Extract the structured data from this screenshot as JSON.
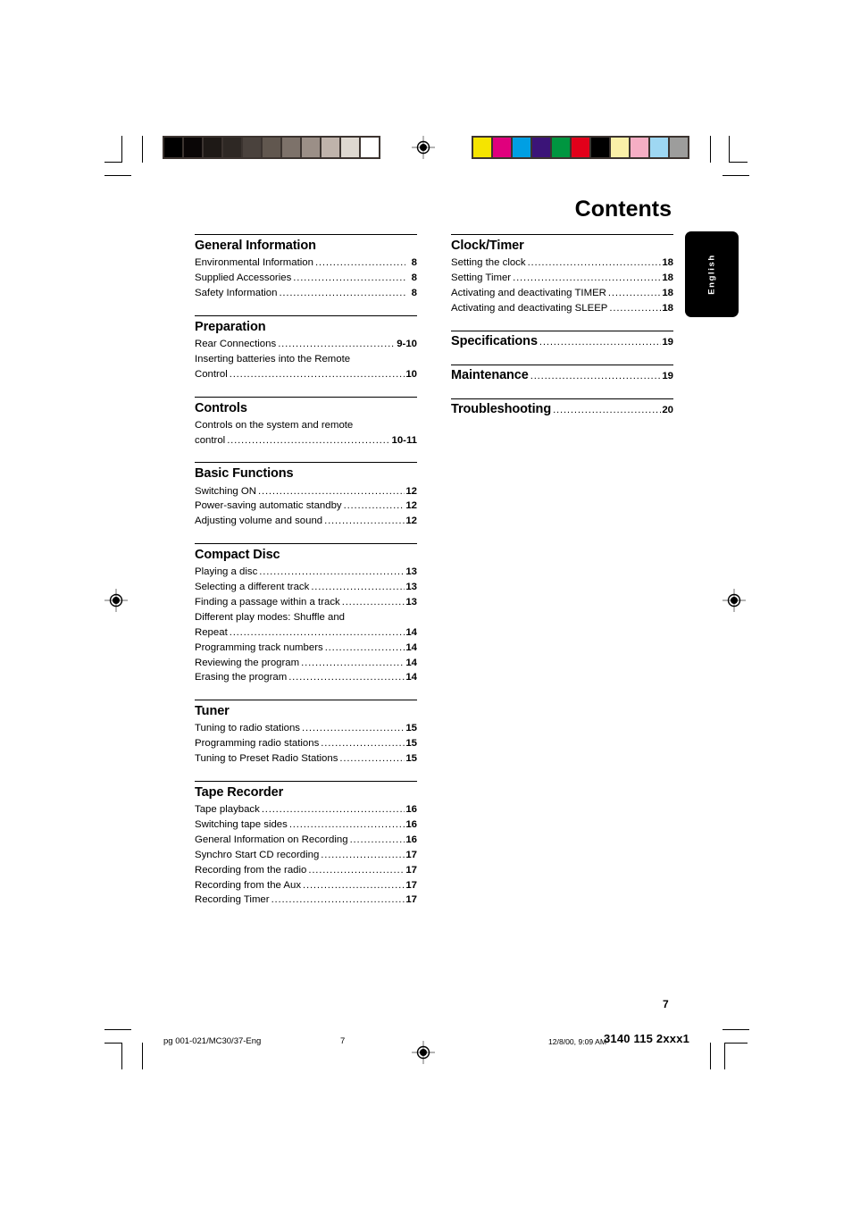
{
  "document": {
    "title": "Contents",
    "language_tab": "English",
    "page_number": "7"
  },
  "calibration": {
    "grayscale_label": "grayscale-calibration-bar",
    "grayscale_swatches": [
      "#000000",
      "#0a0606",
      "#1e1916",
      "#2e2824",
      "#4a423d",
      "#61574f",
      "#7d726a",
      "#9b8f87",
      "#bfb3ab",
      "#ded8d0",
      "#ffffff"
    ],
    "color_label": "color-calibration-bar",
    "color_swatches": [
      "#f5e400",
      "#e0007d",
      "#009fe3",
      "#3b1478",
      "#009640",
      "#e2001a",
      "#000000",
      "#faf0a8",
      "#f5aec4",
      "#9ed7f2",
      "#9d9d9c"
    ]
  },
  "columns": {
    "left": [
      {
        "heading": "General Information",
        "entries": [
          {
            "label": "Environmental Information",
            "page": "8",
            "leader": true
          },
          {
            "label": "Supplied Accessories",
            "page": "8",
            "leader": true
          },
          {
            "label": "Safety Information",
            "page": "8",
            "leader": true
          }
        ]
      },
      {
        "heading": "Preparation",
        "entries": [
          {
            "label": "Rear Connections",
            "page": "9-10",
            "leader": true
          },
          {
            "label": "Inserting batteries into the Remote",
            "page": "",
            "leader": false
          },
          {
            "label": "Control",
            "page": "10",
            "leader": true
          }
        ]
      },
      {
        "heading": "Controls",
        "entries": [
          {
            "label": "Controls on the system and remote",
            "page": "",
            "leader": false
          },
          {
            "label": "control",
            "page": "10-11",
            "leader": true
          }
        ]
      },
      {
        "heading": "Basic Functions",
        "entries": [
          {
            "label": "Switching ON",
            "page": "12",
            "leader": true
          },
          {
            "label": "Power-saving automatic standby",
            "page": "12",
            "leader": true
          },
          {
            "label": "Adjusting volume and sound",
            "page": "12",
            "leader": true
          }
        ]
      },
      {
        "heading": "Compact Disc",
        "entries": [
          {
            "label": "Playing a disc",
            "page": "13",
            "leader": true
          },
          {
            "label": "Selecting a different track",
            "page": "13",
            "leader": true
          },
          {
            "label": "Finding a passage within a track",
            "page": "13",
            "leader": true
          },
          {
            "label": "Different play modes: Shuffle and",
            "page": "",
            "leader": false
          },
          {
            "label": "Repeat",
            "page": "14",
            "leader": true
          },
          {
            "label": "Programming track numbers",
            "page": "14",
            "leader": true
          },
          {
            "label": "Reviewing the program",
            "page": "14",
            "leader": true
          },
          {
            "label": "Erasing the program",
            "page": "14",
            "leader": true
          }
        ]
      },
      {
        "heading": "Tuner",
        "entries": [
          {
            "label": "Tuning to radio stations",
            "page": "15",
            "leader": true
          },
          {
            "label": "Programming radio stations",
            "page": "15",
            "leader": true
          },
          {
            "label": "Tuning to Preset Radio Stations",
            "page": "15",
            "leader": true
          }
        ]
      },
      {
        "heading": "Tape Recorder",
        "entries": [
          {
            "label": "Tape playback",
            "page": "16",
            "leader": true
          },
          {
            "label": "Switching tape sides",
            "page": "16",
            "leader": true
          },
          {
            "label": "General Information on Recording",
            "page": "16",
            "leader": true
          },
          {
            "label": "Synchro Start CD recording",
            "page": "17",
            "leader": true
          },
          {
            "label": "Recording from the radio",
            "page": "17",
            "leader": true
          },
          {
            "label": "Recording from the Aux",
            "page": "17",
            "leader": true
          },
          {
            "label": "Recording Timer",
            "page": "17",
            "leader": true
          }
        ]
      }
    ],
    "right": [
      {
        "heading": "Clock/Timer",
        "heading_page": "",
        "entries": [
          {
            "label": "Setting the clock",
            "page": "18",
            "leader": true
          },
          {
            "label": "Setting Timer",
            "page": "18",
            "leader": true
          },
          {
            "label": "Activating and deactivating TIMER",
            "page": "18",
            "leader": true
          },
          {
            "label": "Activating and deactivating SLEEP",
            "page": "18",
            "leader": true
          }
        ]
      },
      {
        "heading": "Specifications",
        "heading_page": "19",
        "entries": []
      },
      {
        "heading": "Maintenance",
        "heading_page": "19",
        "entries": []
      },
      {
        "heading": "Troubleshooting",
        "heading_page": "20",
        "entries": []
      }
    ]
  },
  "footer": {
    "file_label": "pg 001-021/MC30/37-Eng",
    "page_label": "7",
    "timestamp": "12/8/00, 9:09 AM",
    "doc_code": "3140 115 2xxx1"
  }
}
